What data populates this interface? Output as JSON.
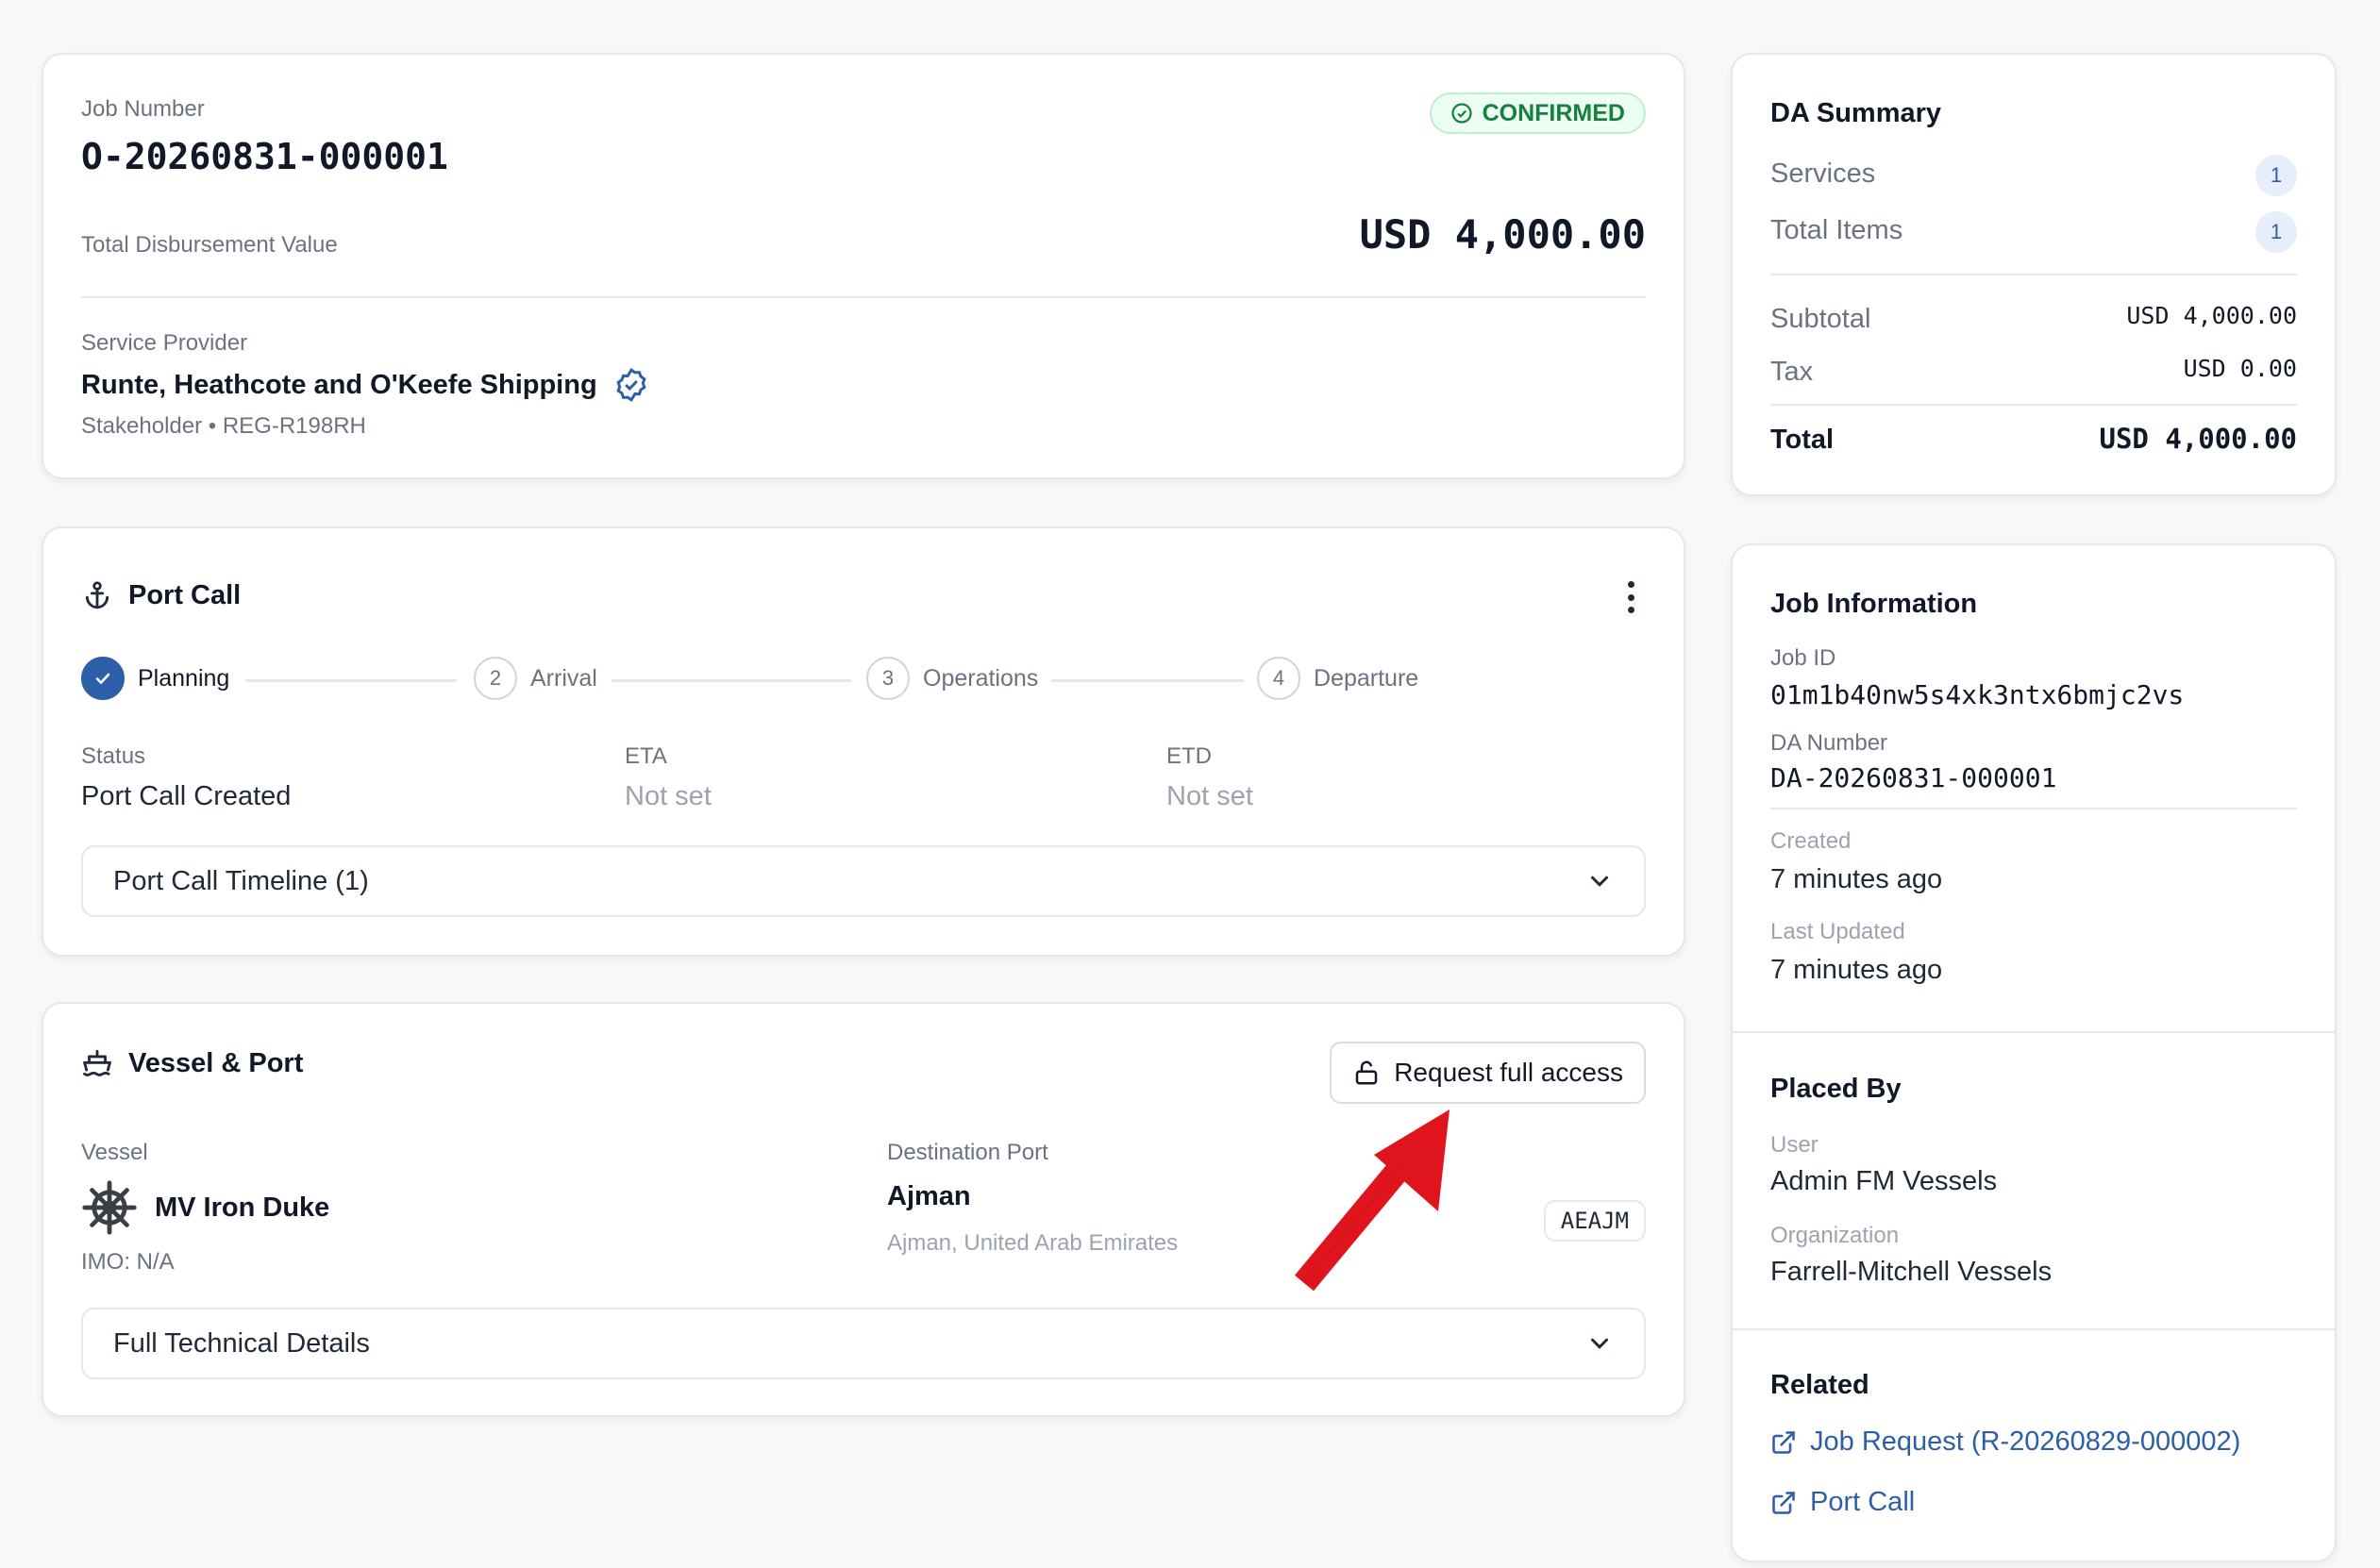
{
  "job": {
    "number_label": "Job Number",
    "number": "O-20260831-000001",
    "status": "CONFIRMED",
    "total_label": "Total Disbursement Value",
    "total_value": "USD 4,000.00",
    "provider_label": "Service Provider",
    "provider_name": "Runte, Heathcote and O'Keefe Shipping",
    "provider_meta": "Stakeholder • REG-R198RH"
  },
  "port_call": {
    "title": "Port Call",
    "steps": [
      {
        "num": "1",
        "label": "Planning"
      },
      {
        "num": "2",
        "label": "Arrival"
      },
      {
        "num": "3",
        "label": "Operations"
      },
      {
        "num": "4",
        "label": "Departure"
      }
    ],
    "status_label": "Status",
    "status_value": "Port Call Created",
    "eta_label": "ETA",
    "eta_value": "Not set",
    "etd_label": "ETD",
    "etd_value": "Not set",
    "timeline_label": "Port Call Timeline (1)"
  },
  "vessel": {
    "title": "Vessel & Port",
    "request_label": "Request full access",
    "vessel_label": "Vessel",
    "vessel_name": "MV Iron Duke",
    "imo": "IMO: N/A",
    "dest_label": "Destination Port",
    "dest_name": "Ajman",
    "dest_country": "Ajman, United Arab Emirates",
    "dest_code": "AEAJM",
    "details_label": "Full Technical Details"
  },
  "da_summary": {
    "title": "DA Summary",
    "services_label": "Services",
    "services_count": "1",
    "items_label": "Total Items",
    "items_count": "1",
    "subtotal_label": "Subtotal",
    "subtotal_value": "USD 4,000.00",
    "tax_label": "Tax",
    "tax_value": "USD 0.00",
    "total_label": "Total",
    "total_value": "USD 4,000.00"
  },
  "job_info": {
    "title": "Job Information",
    "job_id_label": "Job ID",
    "job_id": "01m1b40nw5s4xk3ntx6bmjc2vs",
    "da_number_label": "DA Number",
    "da_number": "DA-20260831-000001",
    "created_label": "Created",
    "created_value": "7 minutes ago",
    "updated_label": "Last Updated",
    "updated_value": "7 minutes ago"
  },
  "placed_by": {
    "title": "Placed By",
    "user_label": "User",
    "user_value": "Admin FM Vessels",
    "org_label": "Organization",
    "org_value": "Farrell-Mitchell Vessels"
  },
  "related": {
    "title": "Related",
    "links": [
      "Job Request (R-20260829-000002)",
      "Port Call"
    ]
  },
  "colors": {
    "accent": "#2d5fa8",
    "success": "#16803c",
    "arrow": "#e0141c"
  }
}
